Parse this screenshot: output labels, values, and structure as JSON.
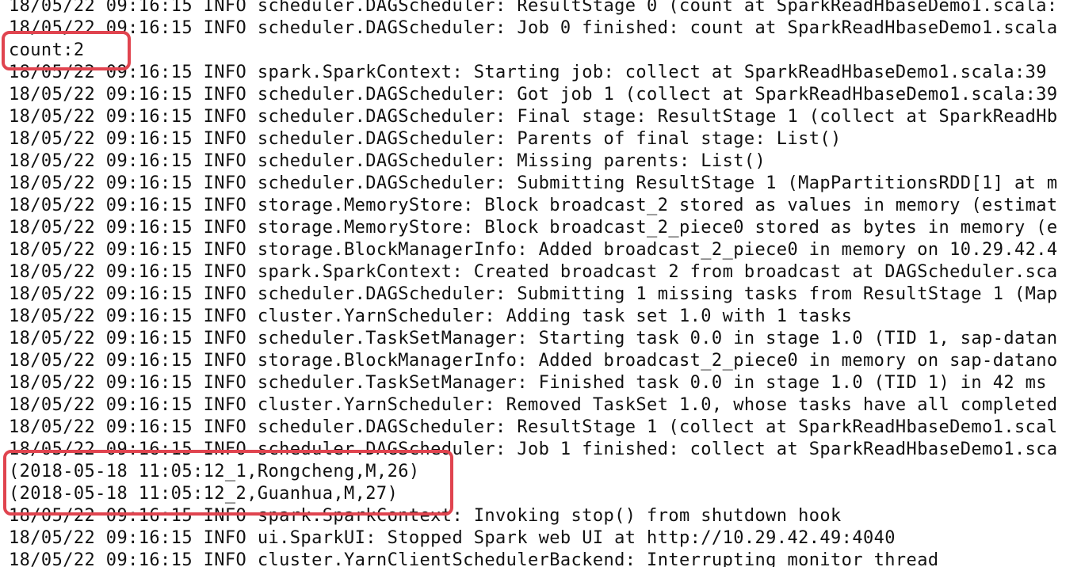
{
  "terminal": {
    "lines": [
      "18/05/22 09:16:15 INFO scheduler.DAGScheduler: ResultStage 0 (count at SparkReadHbaseDemo1.scala:",
      "18/05/22 09:16:15 INFO scheduler.DAGScheduler: Job 0 finished: count at SparkReadHbaseDemo1.scala",
      "count:2",
      "18/05/22 09:16:15 INFO spark.SparkContext: Starting job: collect at SparkReadHbaseDemo1.scala:39",
      "18/05/22 09:16:15 INFO scheduler.DAGScheduler: Got job 1 (collect at SparkReadHbaseDemo1.scala:39",
      "18/05/22 09:16:15 INFO scheduler.DAGScheduler: Final stage: ResultStage 1 (collect at SparkReadHb",
      "18/05/22 09:16:15 INFO scheduler.DAGScheduler: Parents of final stage: List()",
      "18/05/22 09:16:15 INFO scheduler.DAGScheduler: Missing parents: List()",
      "18/05/22 09:16:15 INFO scheduler.DAGScheduler: Submitting ResultStage 1 (MapPartitionsRDD[1] at m",
      "18/05/22 09:16:15 INFO storage.MemoryStore: Block broadcast_2 stored as values in memory (estimat",
      "18/05/22 09:16:15 INFO storage.MemoryStore: Block broadcast_2_piece0 stored as bytes in memory (e",
      "18/05/22 09:16:15 INFO storage.BlockManagerInfo: Added broadcast_2_piece0 in memory on 10.29.42.4",
      "18/05/22 09:16:15 INFO spark.SparkContext: Created broadcast 2 from broadcast at DAGScheduler.sca",
      "18/05/22 09:16:15 INFO scheduler.DAGScheduler: Submitting 1 missing tasks from ResultStage 1 (Map",
      "18/05/22 09:16:15 INFO cluster.YarnScheduler: Adding task set 1.0 with 1 tasks",
      "18/05/22 09:16:15 INFO scheduler.TaskSetManager: Starting task 0.0 in stage 1.0 (TID 1, sap-datan",
      "18/05/22 09:16:15 INFO storage.BlockManagerInfo: Added broadcast_2_piece0 in memory on sap-datano",
      "18/05/22 09:16:15 INFO scheduler.TaskSetManager: Finished task 0.0 in stage 1.0 (TID 1) in 42 ms",
      "18/05/22 09:16:15 INFO cluster.YarnScheduler: Removed TaskSet 1.0, whose tasks have all completed",
      "18/05/22 09:16:15 INFO scheduler.DAGScheduler: ResultStage 1 (collect at SparkReadHbaseDemo1.scal",
      "18/05/22 09:16:15 INFO scheduler.DAGScheduler: Job 1 finished: collect at SparkReadHbaseDemo1.sca",
      "(2018-05-18 11:05:12_1,Rongcheng,M,26)",
      "(2018-05-18 11:05:12_2,Guanhua,M,27)",
      "18/05/22 09:16:15 INFO spark.SparkContext: Invoking stop() from shutdown hook",
      "18/05/22 09:16:15 INFO ui.SparkUI: Stopped Spark web UI at http://10.29.42.49:4040",
      "18/05/22 09:16:15 INFO cluster.YarnClientSchedulerBackend: Interrupting monitor thread"
    ]
  },
  "colors": {
    "highlight": "#e0444f",
    "text": "#111111",
    "background": "#ffffff"
  }
}
